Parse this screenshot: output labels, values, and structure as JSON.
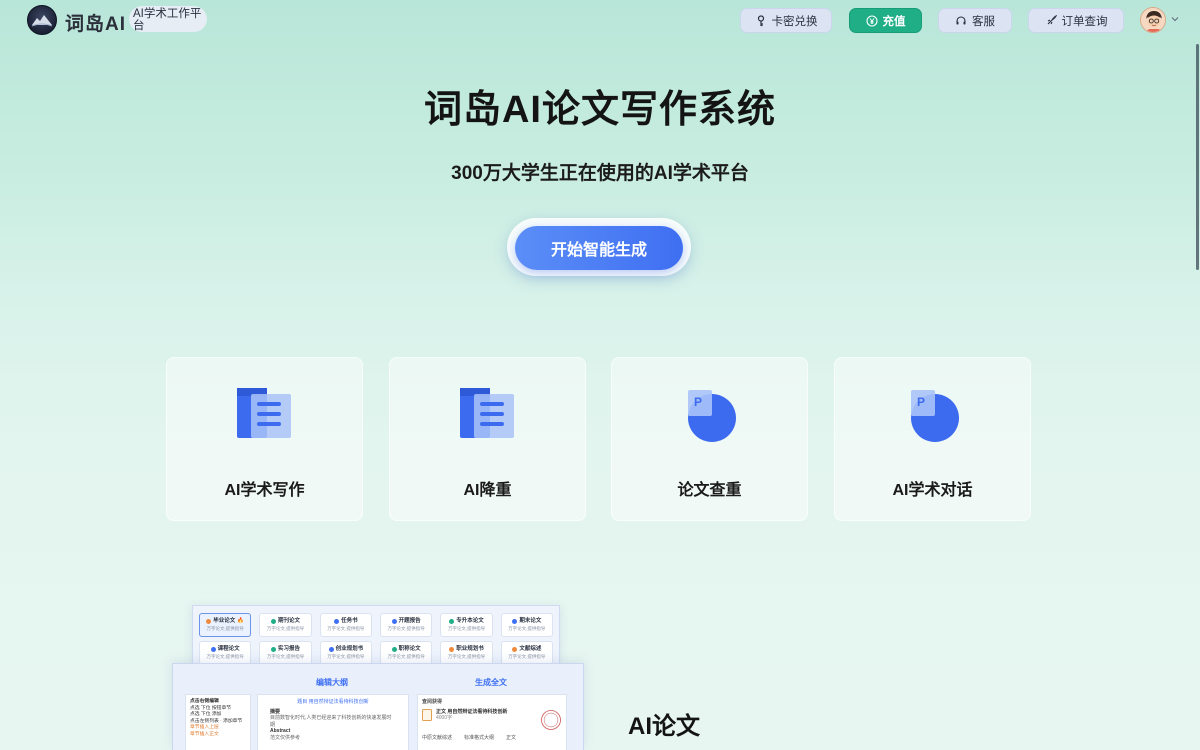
{
  "header": {
    "brand": "词岛AI",
    "tag": "AI学术工作平台",
    "nav": [
      {
        "label": "卡密兑换",
        "icon": "key-icon"
      },
      {
        "label": "充值",
        "icon": "yen-icon"
      },
      {
        "label": "客服",
        "icon": "headset-icon"
      },
      {
        "label": "订单查询",
        "icon": "rocket-icon"
      }
    ]
  },
  "hero": {
    "title": "词岛AI论文写作系统",
    "subtitle": "300万大学生正在使用的AI学术平台",
    "cta": "开始智能生成"
  },
  "cards": [
    {
      "label": "AI学术写作",
      "icon": "document-icon"
    },
    {
      "label": "AI降重",
      "icon": "document-icon"
    },
    {
      "label": "论文查重",
      "icon": "pie-report-icon"
    },
    {
      "label": "AI学术对话",
      "icon": "pie-report-icon"
    }
  ],
  "preview": {
    "chips": [
      {
        "title": "毕业论文",
        "sub": "万字论文,提供指导",
        "color": "#f08a3c",
        "active": true
      },
      {
        "title": "期刊论文",
        "sub": "万字论文,提供指导",
        "color": "#1fae86"
      },
      {
        "title": "任务书",
        "sub": "万字论文,提供指导",
        "color": "#3f6ff2"
      },
      {
        "title": "开题报告",
        "sub": "万字论文,提供指导",
        "color": "#3f6ff2"
      },
      {
        "title": "专升本论文",
        "sub": "万字论文,提供指导",
        "color": "#1fae86"
      },
      {
        "title": "期末论文",
        "sub": "万字论文,提供指导",
        "color": "#3f6ff2"
      },
      {
        "title": "课程论文",
        "sub": "万字论文,提供指导",
        "color": "#3f6ff2"
      },
      {
        "title": "实习报告",
        "sub": "万字论文,提供指导",
        "color": "#1fae86"
      },
      {
        "title": "创业规划书",
        "sub": "万字论文,提供指导",
        "color": "#3f6ff2"
      },
      {
        "title": "职称论文",
        "sub": "万字论文,提供指导",
        "color": "#1fae86"
      },
      {
        "title": "职业规划书",
        "sub": "万字论文,提供指导",
        "color": "#f08a3c"
      },
      {
        "title": "文献综述",
        "sub": "万字论文,提供指导",
        "color": "#f08a3c"
      }
    ],
    "tab_outline": "编辑大纲",
    "tab_full": "生成全文",
    "col1_title": "点击右侧编辑",
    "col1_lines": [
      "点选 下位 按钮章节",
      "点选 下位 添加",
      "点击左侧列表 · 添加章节",
      "章节插入上层",
      "章节插入正文"
    ],
    "col2_heading": "题目 用自然辩证法看待科技创新",
    "col2_abstract": "摘要",
    "col2_abstract_text": "目前数智化时代,人类已经迎来了科技创新的快速发展时期",
    "col2_english": "Abstract",
    "col2_note": "范文仅供参考",
    "col3_heading": "查阅获得",
    "col3_title": "正文 用自然辩证法看待科技创新",
    "col3_count": "4000字",
    "col3_items": [
      "中原文献综述",
      "标准格式大纲",
      "正文"
    ]
  },
  "section_title": "AI论文"
}
